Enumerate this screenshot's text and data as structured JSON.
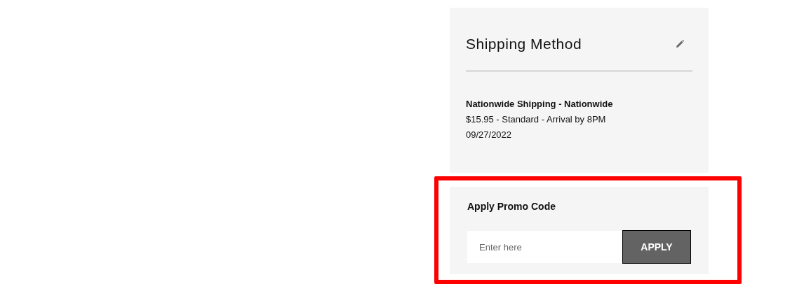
{
  "shipping_method": {
    "title": "Shipping Method",
    "name": "Nationwide Shipping - Nationwide",
    "details": "$15.95 - Standard - Arrival by 8PM",
    "date": "09/27/2022"
  },
  "promo": {
    "title": "Apply Promo Code",
    "placeholder": "Enter here",
    "button": "APPLY",
    "highlighted": true
  }
}
